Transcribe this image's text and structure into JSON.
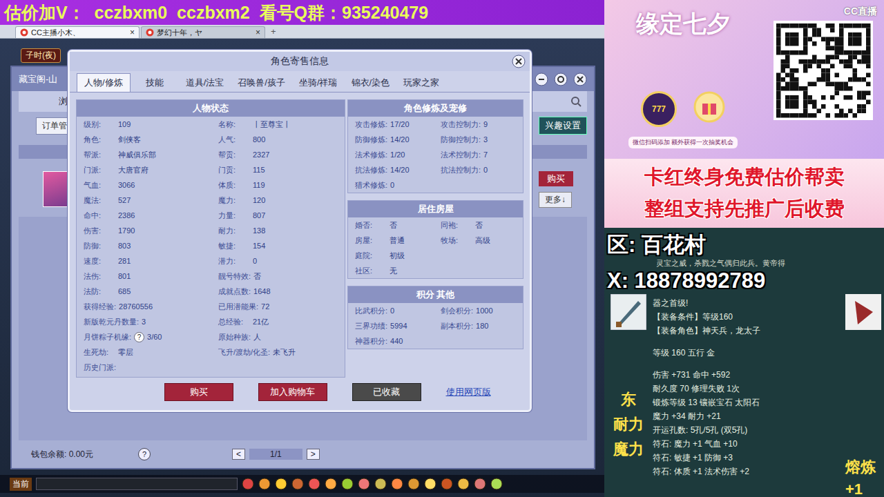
{
  "banner": {
    "text": "估价加V：  cczbxm0  cczbxm2  看号Q群：935240479"
  },
  "browser": {
    "tabs": [
      {
        "label": "CC主播小木、",
        "selected": true,
        "close": "×"
      },
      {
        "label": "梦幻十年，ヤ",
        "selected": false,
        "close": "×"
      }
    ],
    "new_tab": "+"
  },
  "game": {
    "time": "子时(夜)",
    "market": {
      "title": "藏宝阁-山",
      "browse": "浏览",
      "order": "订单管",
      "interest": "兴趣设置",
      "buy": "购买",
      "more": "更多↓",
      "wallet": "钱包余额: 0.00元",
      "help": "?",
      "prev": "<",
      "page": "1/1",
      "next": ">"
    },
    "chat_channel": "当前"
  },
  "dialog": {
    "title": "角色寄售信息",
    "tabs": [
      {
        "label": "人物/修炼",
        "selected": true
      },
      {
        "label": "技能",
        "selected": false
      },
      {
        "label": "道具/法宝",
        "selected": false
      },
      {
        "label": "召唤兽/孩子",
        "selected": false
      },
      {
        "label": "坐骑/祥瑞",
        "selected": false
      },
      {
        "label": "锦衣/染色",
        "selected": false
      },
      {
        "label": "玩家之家",
        "selected": false
      }
    ],
    "status": {
      "title": "人物状态",
      "rows": [
        [
          {
            "label": "级别:",
            "value": "109"
          },
          {
            "label": "名称:",
            "value": "丨至尊宝丨"
          }
        ],
        [
          {
            "label": "角色:",
            "value": "剑侠客"
          },
          {
            "label": "人气:",
            "value": "800"
          }
        ],
        [
          {
            "label": "帮派:",
            "value": "神威俱乐部"
          },
          {
            "label": "帮贡:",
            "value": "2327"
          }
        ],
        [
          {
            "label": "门派:",
            "value": "大唐官府"
          },
          {
            "label": "门贡:",
            "value": "115"
          }
        ],
        [
          {
            "label": "气血:",
            "value": "3066"
          },
          {
            "label": "体质:",
            "value": "119"
          }
        ],
        [
          {
            "label": "魔法:",
            "value": "527"
          },
          {
            "label": "魔力:",
            "value": "120"
          }
        ],
        [
          {
            "label": "命中:",
            "value": "2386"
          },
          {
            "label": "力量:",
            "value": "807"
          }
        ],
        [
          {
            "label": "伤害:",
            "value": "1790"
          },
          {
            "label": "耐力:",
            "value": "138"
          }
        ],
        [
          {
            "label": "防御:",
            "value": "803"
          },
          {
            "label": "敏捷:",
            "value": "154"
          }
        ],
        [
          {
            "label": "速度:",
            "value": "281"
          },
          {
            "label": "潜力:",
            "value": "0"
          }
        ],
        [
          {
            "label": "法伤:",
            "value": "801"
          },
          {
            "label": "靓号特效:",
            "value": "否"
          }
        ],
        [
          {
            "label": "法防:",
            "value": "685"
          },
          {
            "label": "成就点数:",
            "value": "1648"
          }
        ],
        [
          {
            "label": "获得经验:",
            "value": "28760556"
          },
          {
            "label": "已用潜能果:",
            "value": "72"
          }
        ],
        [
          {
            "label": "新版乾元丹数量:",
            "value": "3"
          },
          {
            "label": "总经验:",
            "value": "21亿"
          }
        ],
        [
          {
            "label": "月饼粽子机缘:",
            "hint": "?",
            "value": "3/60"
          },
          {
            "label": "原始种族:",
            "value": "人"
          }
        ],
        [
          {
            "label": "生死劫:",
            "value": "零层"
          },
          {
            "label": "飞升/渡劫/化圣:",
            "value": "未飞升"
          }
        ],
        [
          {
            "label": "历史门派:",
            "value": ""
          }
        ]
      ]
    },
    "sections": [
      {
        "title": "角色修炼及宠修",
        "rows": [
          [
            {
              "label": "攻击修炼:",
              "value": "17/20"
            },
            {
              "label": "攻击控制力:",
              "value": "9"
            }
          ],
          [
            {
              "label": "防御修炼:",
              "value": "14/20"
            },
            {
              "label": "防御控制力:",
              "value": "3"
            }
          ],
          [
            {
              "label": "法术修炼:",
              "value": "1/20"
            },
            {
              "label": "法术控制力:",
              "value": "7"
            }
          ],
          [
            {
              "label": "抗法修炼:",
              "value": "14/20"
            },
            {
              "label": "抗法控制力:",
              "value": "0"
            }
          ],
          [
            {
              "label": "猎术修炼:",
              "value": "0"
            }
          ]
        ]
      },
      {
        "title": "居住房屋",
        "rows": [
          [
            {
              "label": "婚否:",
              "value": "否"
            },
            {
              "label": "同袍:",
              "value": "否"
            }
          ],
          [
            {
              "label": "房屋:",
              "value": "普通"
            },
            {
              "label": "牧场:",
              "value": "高级"
            }
          ],
          [
            {
              "label": "庭院:",
              "value": "初级"
            }
          ],
          [
            {
              "label": "社区:",
              "value": "无"
            }
          ]
        ]
      },
      {
        "title": "积分 其他",
        "rows": [
          [
            {
              "label": "比武积分:",
              "value": "0"
            },
            {
              "label": "剑会积分:",
              "value": "1000"
            }
          ],
          [
            {
              "label": "三界功绩:",
              "value": "5994"
            },
            {
              "label": "副本积分:",
              "value": "180"
            }
          ],
          [
            {
              "label": "神器积分:",
              "value": "440"
            }
          ]
        ]
      }
    ],
    "buttons": [
      {
        "label": "购买",
        "kind": "primary"
      },
      {
        "label": "加入购物车",
        "kind": "primary"
      },
      {
        "label": "已收藏",
        "kind": "muted"
      },
      {
        "label": "使用网页版",
        "kind": "link"
      }
    ]
  },
  "ad": {
    "event_title": "缘定七夕",
    "event_badge": "777",
    "event_note": "微信扫码添加 额外获得一次抽奖机会",
    "logo": "CC直播",
    "slogans": [
      "卡红终身免费估价帮卖",
      "整组支持先推广后收费"
    ],
    "server": "区: 百花村",
    "contact": "X: 18878992789",
    "item": {
      "desc": "灵宝之威，杀戮之气偶归此兵。黄帝得",
      "lines": [
        "器之首级!",
        "【装备条件】等级160",
        "【装备角色】神天兵，龙太子",
        "等级 160 五行 金",
        "伤害 +731 命中 +592",
        "耐久度 70 修理失败 1次",
        "锻炼等级 13 镶嵌宝石 太阳石",
        "魔力 +34 耐力 +21",
        "开运孔数: 5孔/5孔 (双5孔)",
        "符石: 魔力 +1 气血 +10",
        "符石: 敏捷 +1 防御 +3",
        "符石: 体质 +1 法术伤害 +2"
      ],
      "side_left": [
        "东",
        "耐力",
        "魔力"
      ],
      "side_right": [
        "熔炼",
        "+1"
      ]
    }
  }
}
